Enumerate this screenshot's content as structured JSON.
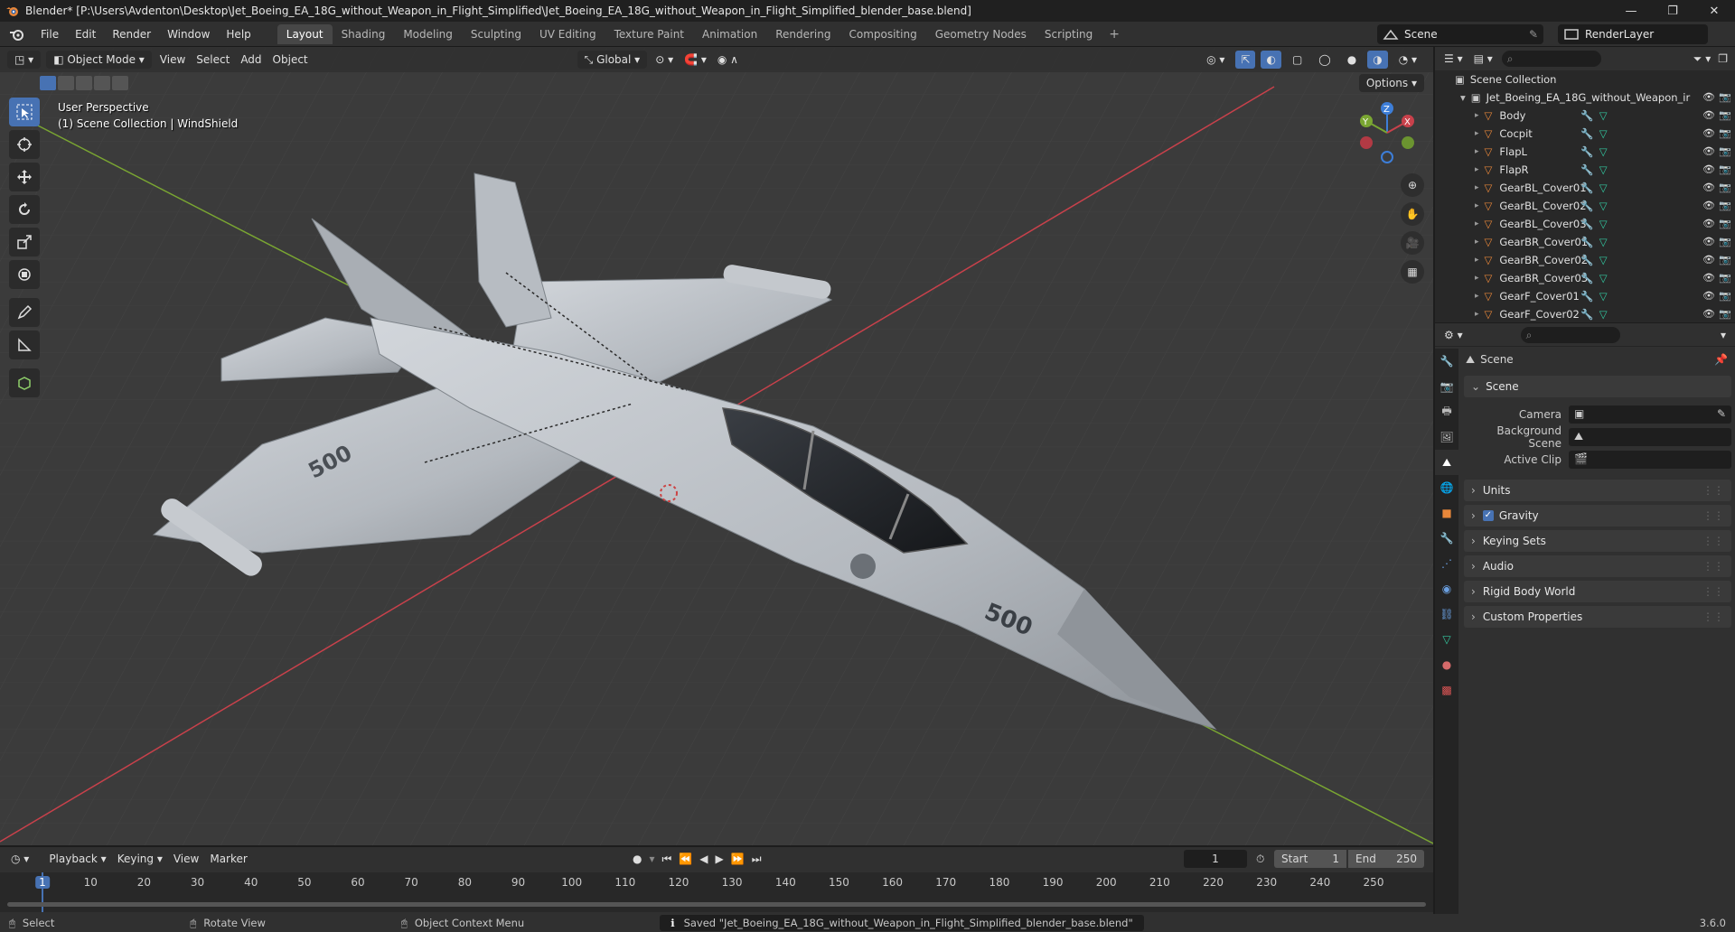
{
  "window": {
    "title": "Blender* [P:\\Users\\Avdenton\\Desktop\\Jet_Boeing_EA_18G_without_Weapon_in_Flight_Simplified\\Jet_Boeing_EA_18G_without_Weapon_in_Flight_Simplified_blender_base.blend]",
    "controls": [
      "—",
      "❐",
      "✕"
    ]
  },
  "menu": [
    "File",
    "Edit",
    "Render",
    "Window",
    "Help"
  ],
  "workspaces": [
    "Layout",
    "Shading",
    "Modeling",
    "Sculpting",
    "UV Editing",
    "Texture Paint",
    "Animation",
    "Rendering",
    "Compositing",
    "Geometry Nodes",
    "Scripting"
  ],
  "active_workspace": "Layout",
  "add_workspace": "+",
  "scene_name": "Scene",
  "render_layer": "RenderLayer",
  "viewport": {
    "mode": "Object Mode",
    "menus": [
      "View",
      "Select",
      "Add",
      "Object"
    ],
    "transform_orientation": "Global",
    "options_label": "Options",
    "info_line1": "User Perspective",
    "info_line2": "(1) Scene Collection | WindShield",
    "gizmo": {
      "x": "X",
      "y": "Y",
      "z": "Z"
    },
    "aircraft_markings": "500"
  },
  "outliner": {
    "root": "Scene Collection",
    "collection": "Jet_Boeing_EA_18G_without_Weapon_ir",
    "items": [
      "Body",
      "Cocpit",
      "FlapL",
      "FlapR",
      "GearBL_Cover01",
      "GearBL_Cover02",
      "GearBL_Cover03",
      "GearBR_Cover01",
      "GearBR_Cover02",
      "GearBR_Cover03",
      "GearF_Cover01",
      "GearF_Cover02"
    ]
  },
  "properties": {
    "context": "Scene",
    "scene_panel": "Scene",
    "fields": [
      {
        "label": "Camera"
      },
      {
        "label": "Background Scene"
      },
      {
        "label": "Active Clip"
      }
    ],
    "panels": [
      {
        "label": "Units",
        "checkbox": false
      },
      {
        "label": "Gravity",
        "checkbox": true
      },
      {
        "label": "Keying Sets",
        "checkbox": false
      },
      {
        "label": "Audio",
        "checkbox": false
      },
      {
        "label": "Rigid Body World",
        "checkbox": false
      },
      {
        "label": "Custom Properties",
        "checkbox": false
      }
    ]
  },
  "timeline": {
    "menus": [
      "Playback",
      "Keying",
      "View",
      "Marker"
    ],
    "current_frame": "1",
    "start_label": "Start",
    "start": "1",
    "end_label": "End",
    "end": "250",
    "ticks": [
      "1",
      "10",
      "20",
      "30",
      "40",
      "50",
      "60",
      "70",
      "80",
      "90",
      "100",
      "110",
      "120",
      "130",
      "140",
      "150",
      "160",
      "170",
      "180",
      "190",
      "200",
      "210",
      "220",
      "230",
      "240",
      "250"
    ]
  },
  "status": {
    "select": "Select",
    "rotate": "Rotate View",
    "context_menu": "Object Context Menu",
    "message": "Saved \"Jet_Boeing_EA_18G_without_Weapon_in_Flight_Simplified_blender_base.blend\"",
    "version": "3.6.0"
  },
  "colors": {
    "accent": "#4772b3",
    "x_axis": "#c8414b",
    "y_axis": "#7aa632",
    "z_axis": "#3d7ed8",
    "object_orange": "#e8873a",
    "mesh_green": "#33c8a0"
  }
}
